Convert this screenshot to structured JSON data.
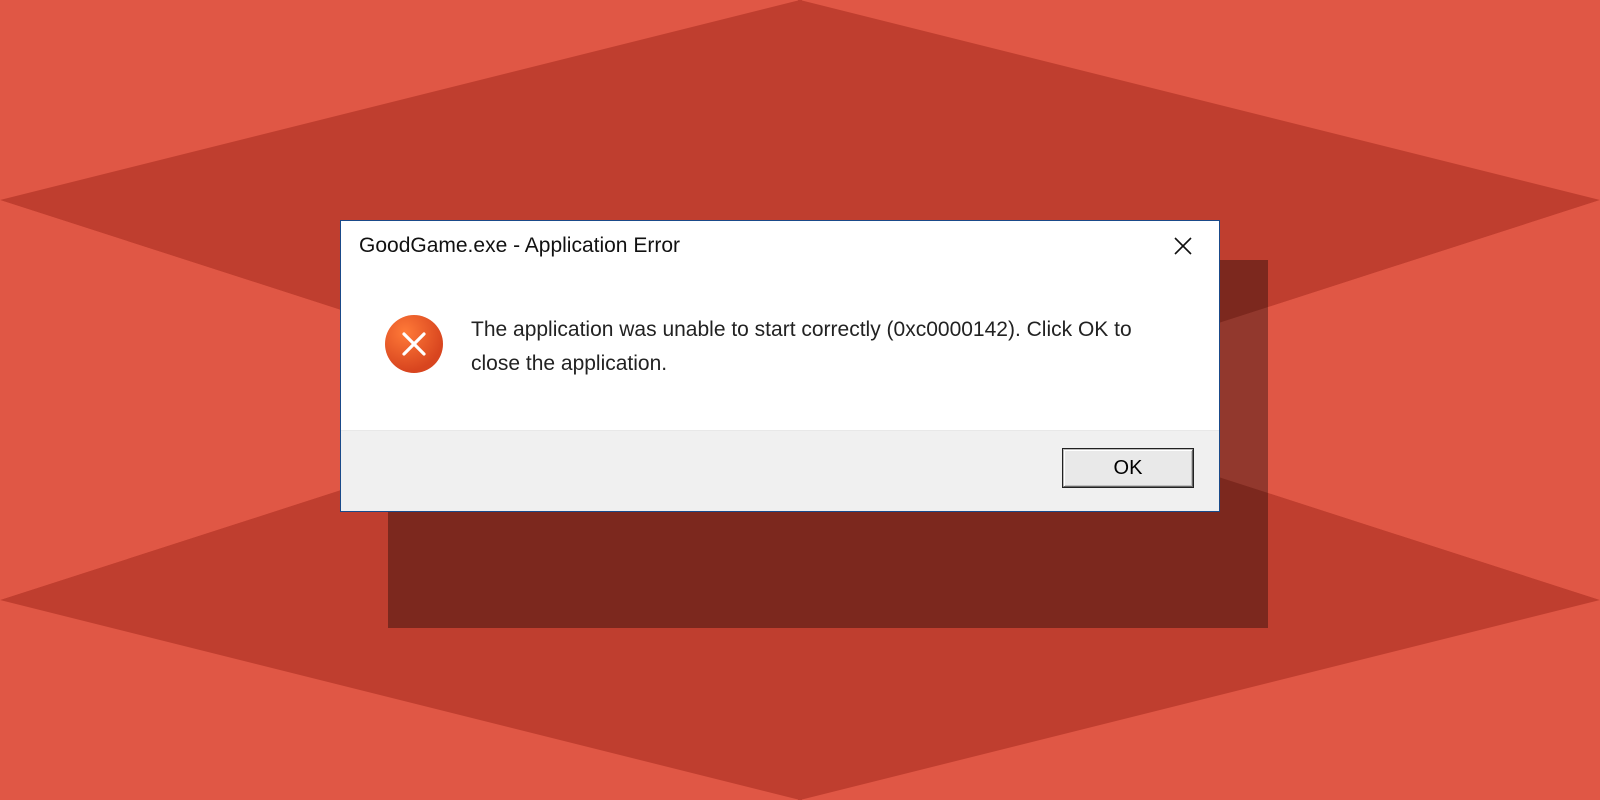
{
  "dialog": {
    "title": "GoodGame.exe - Application Error",
    "message": "The application was unable to start correctly (0xc0000142). Click OK to close the application.",
    "ok_label": "OK"
  },
  "colors": {
    "bg_light": "#e05745",
    "bg_dark": "#bf3e2f",
    "dialog_border": "#1a4a8a",
    "error_icon": "#e04a1f"
  }
}
